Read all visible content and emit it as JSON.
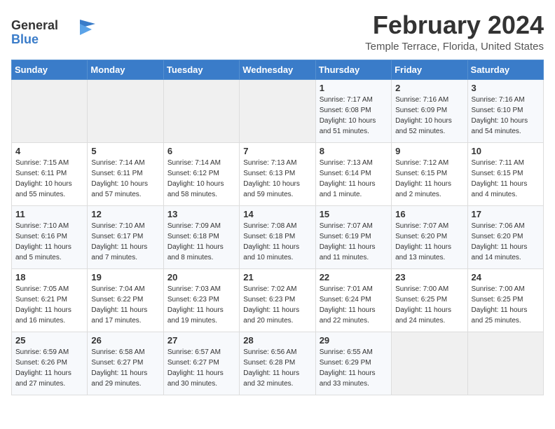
{
  "logo": {
    "line1": "General",
    "line2": "Blue"
  },
  "title": "February 2024",
  "subtitle": "Temple Terrace, Florida, United States",
  "days_of_week": [
    "Sunday",
    "Monday",
    "Tuesday",
    "Wednesday",
    "Thursday",
    "Friday",
    "Saturday"
  ],
  "weeks": [
    [
      {
        "day": "",
        "info": ""
      },
      {
        "day": "",
        "info": ""
      },
      {
        "day": "",
        "info": ""
      },
      {
        "day": "",
        "info": ""
      },
      {
        "day": "1",
        "info": "Sunrise: 7:17 AM\nSunset: 6:08 PM\nDaylight: 10 hours\nand 51 minutes."
      },
      {
        "day": "2",
        "info": "Sunrise: 7:16 AM\nSunset: 6:09 PM\nDaylight: 10 hours\nand 52 minutes."
      },
      {
        "day": "3",
        "info": "Sunrise: 7:16 AM\nSunset: 6:10 PM\nDaylight: 10 hours\nand 54 minutes."
      }
    ],
    [
      {
        "day": "4",
        "info": "Sunrise: 7:15 AM\nSunset: 6:11 PM\nDaylight: 10 hours\nand 55 minutes."
      },
      {
        "day": "5",
        "info": "Sunrise: 7:14 AM\nSunset: 6:11 PM\nDaylight: 10 hours\nand 57 minutes."
      },
      {
        "day": "6",
        "info": "Sunrise: 7:14 AM\nSunset: 6:12 PM\nDaylight: 10 hours\nand 58 minutes."
      },
      {
        "day": "7",
        "info": "Sunrise: 7:13 AM\nSunset: 6:13 PM\nDaylight: 10 hours\nand 59 minutes."
      },
      {
        "day": "8",
        "info": "Sunrise: 7:13 AM\nSunset: 6:14 PM\nDaylight: 11 hours\nand 1 minute."
      },
      {
        "day": "9",
        "info": "Sunrise: 7:12 AM\nSunset: 6:15 PM\nDaylight: 11 hours\nand 2 minutes."
      },
      {
        "day": "10",
        "info": "Sunrise: 7:11 AM\nSunset: 6:15 PM\nDaylight: 11 hours\nand 4 minutes."
      }
    ],
    [
      {
        "day": "11",
        "info": "Sunrise: 7:10 AM\nSunset: 6:16 PM\nDaylight: 11 hours\nand 5 minutes."
      },
      {
        "day": "12",
        "info": "Sunrise: 7:10 AM\nSunset: 6:17 PM\nDaylight: 11 hours\nand 7 minutes."
      },
      {
        "day": "13",
        "info": "Sunrise: 7:09 AM\nSunset: 6:18 PM\nDaylight: 11 hours\nand 8 minutes."
      },
      {
        "day": "14",
        "info": "Sunrise: 7:08 AM\nSunset: 6:18 PM\nDaylight: 11 hours\nand 10 minutes."
      },
      {
        "day": "15",
        "info": "Sunrise: 7:07 AM\nSunset: 6:19 PM\nDaylight: 11 hours\nand 11 minutes."
      },
      {
        "day": "16",
        "info": "Sunrise: 7:07 AM\nSunset: 6:20 PM\nDaylight: 11 hours\nand 13 minutes."
      },
      {
        "day": "17",
        "info": "Sunrise: 7:06 AM\nSunset: 6:20 PM\nDaylight: 11 hours\nand 14 minutes."
      }
    ],
    [
      {
        "day": "18",
        "info": "Sunrise: 7:05 AM\nSunset: 6:21 PM\nDaylight: 11 hours\nand 16 minutes."
      },
      {
        "day": "19",
        "info": "Sunrise: 7:04 AM\nSunset: 6:22 PM\nDaylight: 11 hours\nand 17 minutes."
      },
      {
        "day": "20",
        "info": "Sunrise: 7:03 AM\nSunset: 6:23 PM\nDaylight: 11 hours\nand 19 minutes."
      },
      {
        "day": "21",
        "info": "Sunrise: 7:02 AM\nSunset: 6:23 PM\nDaylight: 11 hours\nand 20 minutes."
      },
      {
        "day": "22",
        "info": "Sunrise: 7:01 AM\nSunset: 6:24 PM\nDaylight: 11 hours\nand 22 minutes."
      },
      {
        "day": "23",
        "info": "Sunrise: 7:00 AM\nSunset: 6:25 PM\nDaylight: 11 hours\nand 24 minutes."
      },
      {
        "day": "24",
        "info": "Sunrise: 7:00 AM\nSunset: 6:25 PM\nDaylight: 11 hours\nand 25 minutes."
      }
    ],
    [
      {
        "day": "25",
        "info": "Sunrise: 6:59 AM\nSunset: 6:26 PM\nDaylight: 11 hours\nand 27 minutes."
      },
      {
        "day": "26",
        "info": "Sunrise: 6:58 AM\nSunset: 6:27 PM\nDaylight: 11 hours\nand 29 minutes."
      },
      {
        "day": "27",
        "info": "Sunrise: 6:57 AM\nSunset: 6:27 PM\nDaylight: 11 hours\nand 30 minutes."
      },
      {
        "day": "28",
        "info": "Sunrise: 6:56 AM\nSunset: 6:28 PM\nDaylight: 11 hours\nand 32 minutes."
      },
      {
        "day": "29",
        "info": "Sunrise: 6:55 AM\nSunset: 6:29 PM\nDaylight: 11 hours\nand 33 minutes."
      },
      {
        "day": "",
        "info": ""
      },
      {
        "day": "",
        "info": ""
      }
    ]
  ]
}
